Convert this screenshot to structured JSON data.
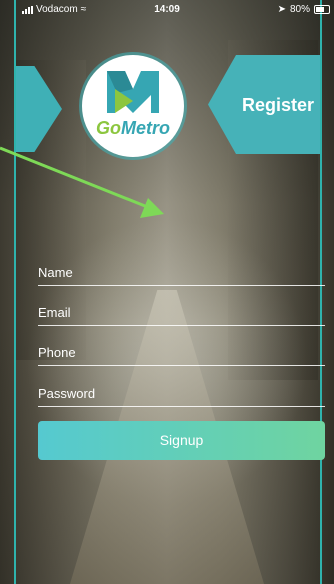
{
  "status_bar": {
    "carrier": "Vodacom",
    "time": "14:09",
    "battery": "80%"
  },
  "tabs": {
    "register_label": "Register"
  },
  "logo": {
    "text_go": "Go",
    "text_metro": "Metro"
  },
  "form": {
    "name_placeholder": "Name",
    "email_placeholder": "Email",
    "phone_placeholder": "Phone",
    "password_placeholder": "Password",
    "signup_label": "Signup"
  },
  "colors": {
    "accent_teal": "#3fb0b6",
    "accent_green": "#8cc63f",
    "arrow_annotation": "#7ed957"
  }
}
